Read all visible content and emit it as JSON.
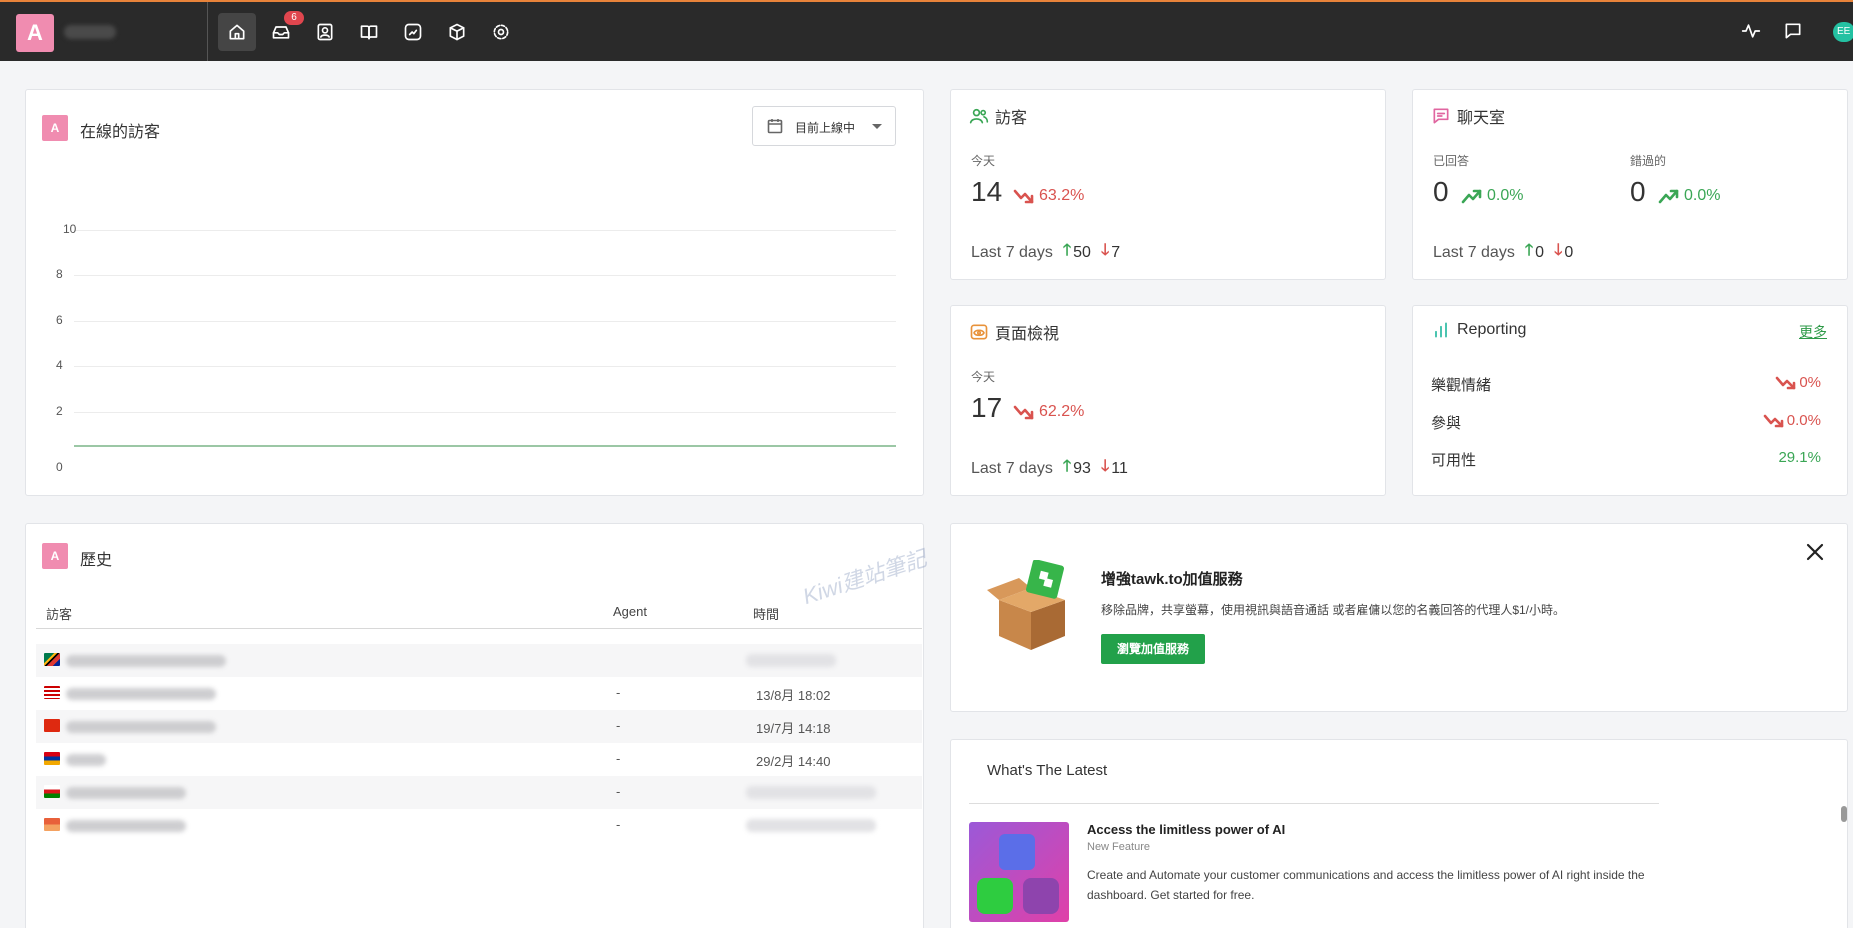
{
  "topbar": {
    "avatar_letter": "A",
    "inbox_badge": "6",
    "nav_icons": [
      "home-icon",
      "inbox-icon",
      "contacts-icon",
      "knowledge-base-icon",
      "reports-icon",
      "addons-icon",
      "settings-icon"
    ],
    "right_icons": [
      "activity-icon",
      "chat-bubble-icon"
    ],
    "edge_button_text": "EE"
  },
  "online_visitors": {
    "avatar_letter": "A",
    "title": "在線的訪客",
    "dropdown_label": "目前上線中",
    "y_ticks": [
      "10",
      "8",
      "6",
      "4",
      "2",
      "0"
    ]
  },
  "chart_data": {
    "type": "line",
    "title": "在線的訪客",
    "xlabel": "",
    "ylabel": "",
    "ylim": [
      0,
      10
    ],
    "yticks": [
      0,
      2,
      4,
      6,
      8,
      10
    ],
    "grid": true,
    "series": [
      {
        "values": [
          0,
          0,
          0,
          0,
          0,
          0,
          0,
          0,
          0,
          0
        ]
      }
    ],
    "color": "#9bc7a5"
  },
  "visitors": {
    "title": "訪客",
    "today_label": "今天",
    "today_value": "14",
    "change": "63.2%",
    "last7_label": "Last 7 days",
    "last7_up": "50",
    "last7_down": "7"
  },
  "chatroom": {
    "title": "聊天室",
    "answered_label": "已回答",
    "answered_value": "0",
    "answered_change": "0.0%",
    "missed_label": "錯過的",
    "missed_value": "0",
    "missed_change": "0.0%",
    "last7_label": "Last 7 days",
    "last7_up": "0",
    "last7_down": "0"
  },
  "pageviews": {
    "title": "頁面檢視",
    "today_label": "今天",
    "today_value": "17",
    "change": "62.2%",
    "last7_label": "Last 7 days",
    "last7_up": "93",
    "last7_down": "11"
  },
  "reporting": {
    "title": "Reporting",
    "more_link": "更多",
    "rows": [
      {
        "label": "樂觀情緒",
        "value": "0%"
      },
      {
        "label": "參與",
        "value": "0.0%"
      },
      {
        "label": "可用性",
        "value": "29.1%"
      }
    ]
  },
  "history": {
    "avatar_letter": "A",
    "title": "歷史",
    "columns": [
      "訪客",
      "Agent",
      "時間"
    ],
    "rows": [
      {
        "flag": "south-africa",
        "agent": "",
        "time": ""
      },
      {
        "flag": "malaysia",
        "agent": "-",
        "time": "13/8月 18:02"
      },
      {
        "flag": "china",
        "agent": "-",
        "time": "19/7月 14:18"
      },
      {
        "flag": "armenia",
        "agent": "-",
        "time": "29/2月 14:40"
      },
      {
        "flag": "oman",
        "agent": "-",
        "time": ""
      },
      {
        "flag": "unknown",
        "agent": "-",
        "time": ""
      }
    ]
  },
  "promo": {
    "title": "增強tawk.to加值服務",
    "description": "移除品牌，共享螢幕，使用視訊與語音通話 或者雇傭以您的名義回答的代理人$1/小時。",
    "button": "瀏覽加值服務",
    "watermark": "Kiwi建站筆記"
  },
  "latest": {
    "title": "What's The Latest",
    "item_title": "Access the limitless power of AI",
    "item_tag": "New Feature",
    "item_body": "Create and Automate your customer communications and access the limitless power of AI right inside the dashboard. Get started for free."
  },
  "colors": {
    "topbar_bg": "#2a2a2a",
    "accent_pink": "#f08cb0",
    "accent_green": "#22a14a",
    "up_green": "#3aa655",
    "down_red": "#d9534f",
    "badge_red": "#e0464e"
  }
}
